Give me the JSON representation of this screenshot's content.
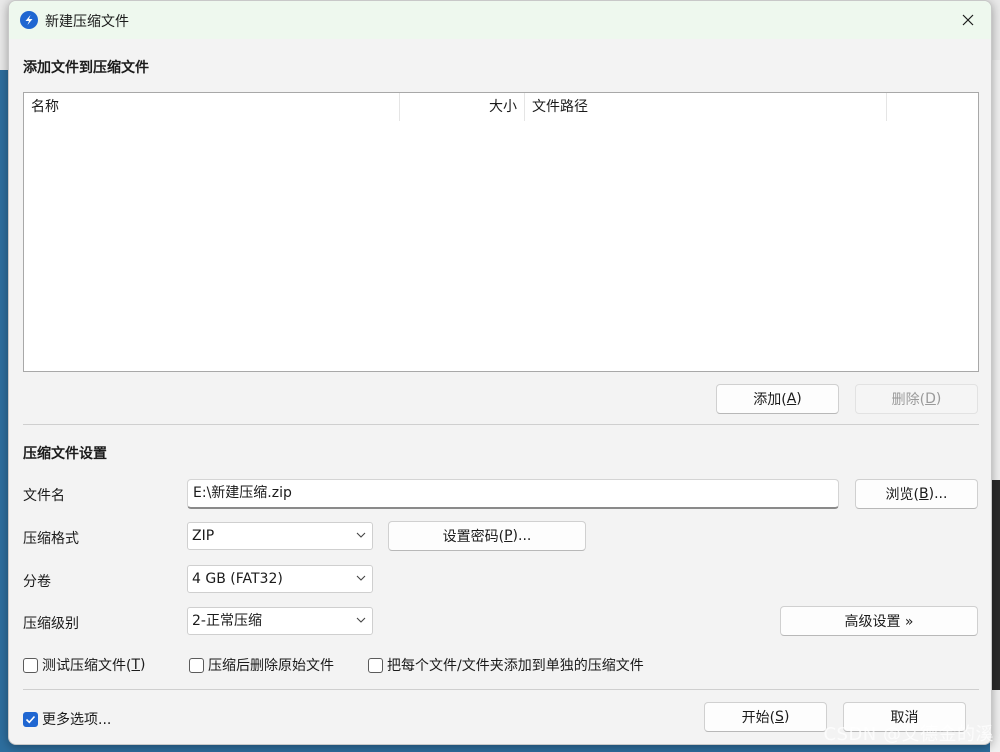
{
  "window": {
    "title": "新建压缩文件"
  },
  "add_section": {
    "title": "添加文件到压缩文件",
    "columns": [
      "名称",
      "大小",
      "文件路径"
    ],
    "add_label": "添加(",
    "add_key": "A",
    "add_end": ")",
    "delete_label": "删除(",
    "delete_key": "D",
    "delete_end": ")"
  },
  "settings": {
    "title": "压缩文件设置",
    "filename_label": "文件名",
    "filename_value": "E:\\新建压缩.zip",
    "browse_label": "浏览(",
    "browse_key": "B",
    "browse_end": ")...",
    "format_label": "压缩格式",
    "format_value": "ZIP",
    "password_label": "设置密码(",
    "password_key": "P",
    "password_end": ")...",
    "split_label": "分卷",
    "split_value": "4 GB (FAT32)",
    "level_label": "压缩级别",
    "level_value": "2-正常压缩",
    "advanced_label": "高级设置 »",
    "test_label": "测试压缩文件(",
    "test_key": "T",
    "test_end": ")",
    "delete_after_label": "压缩后删除原始文件",
    "separate_label": "把每个文件/文件夹添加到单独的压缩文件",
    "test_checked": false,
    "delete_after_checked": false,
    "separate_checked": false
  },
  "footer": {
    "more_options_label": "更多选项...",
    "more_options_checked": true,
    "start_label": "开始(",
    "start_key": "S",
    "start_end": ")",
    "cancel_label": "取消"
  },
  "watermark": "CSDN @艾德金的溪",
  "colors": {
    "accent": "#1f66d1",
    "titlebar": "#eef8ee",
    "window_bg": "#f3f3f3"
  }
}
